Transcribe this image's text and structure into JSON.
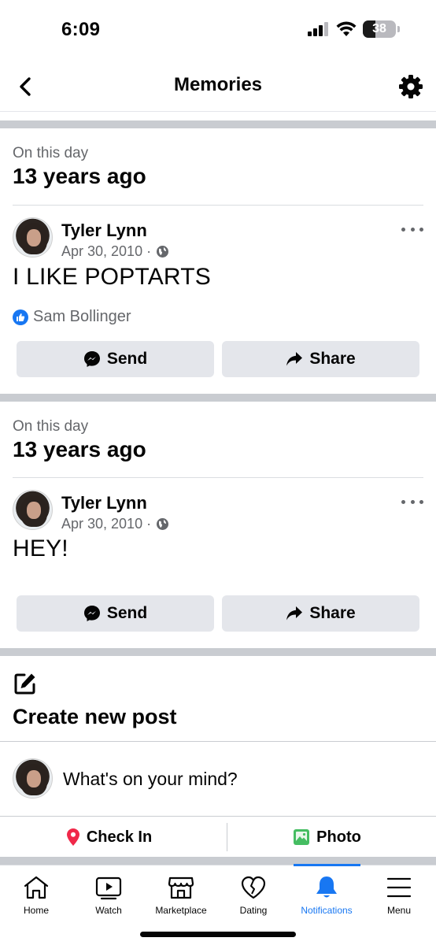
{
  "status_bar": {
    "time": "6:09",
    "battery": "38",
    "battery_level": 0.38
  },
  "header": {
    "title": "Memories",
    "back_icon": "chevron-left-icon",
    "settings_icon": "gear-icon"
  },
  "memories": [
    {
      "kicker": "On this day",
      "heading": "13 years ago",
      "author": "Tyler Lynn",
      "date": "Apr 30, 2010 ·",
      "text": "I LIKE POPTARTS",
      "reaction": "Sam Bollinger",
      "send_label": "Send",
      "share_label": "Share"
    },
    {
      "kicker": "On this day",
      "heading": "13 years ago",
      "author": "Tyler Lynn",
      "date": "Apr 30, 2010 ·",
      "text": "HEY!",
      "send_label": "Send",
      "share_label": "Share"
    }
  ],
  "create_post": {
    "title": "Create new post",
    "placeholder": "What's on your mind?",
    "check_in_label": "Check In",
    "photo_label": "Photo"
  },
  "bottom_nav": {
    "items": [
      {
        "label": "Home",
        "icon": "home-icon"
      },
      {
        "label": "Watch",
        "icon": "watch-icon"
      },
      {
        "label": "Marketplace",
        "icon": "marketplace-icon"
      },
      {
        "label": "Dating",
        "icon": "dating-icon"
      },
      {
        "label": "Notifications",
        "icon": "bell-icon",
        "active": true
      },
      {
        "label": "Menu",
        "icon": "menu-icon"
      }
    ]
  },
  "colors": {
    "accent": "#1877f2",
    "secondary_text": "#65676b",
    "button_bg": "#e4e6eb",
    "divider": "#c9ccd1"
  }
}
